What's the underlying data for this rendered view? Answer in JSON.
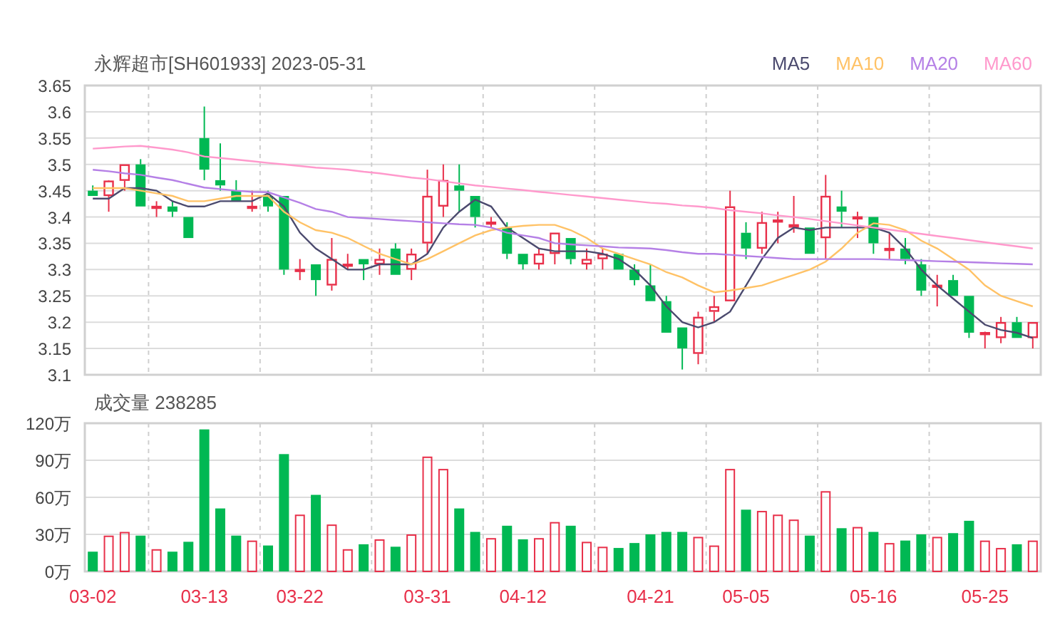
{
  "price_chart": {
    "chart_data": {
      "type": "candlestick",
      "title": "永辉超市[SH601933] 2023-05-31",
      "grid": true,
      "ylim": [
        3.1,
        3.65
      ],
      "yticks": [
        3.1,
        3.15,
        3.2,
        3.25,
        3.3,
        3.35,
        3.4,
        3.45,
        3.5,
        3.55,
        3.6,
        3.65
      ],
      "categories": [
        null,
        null,
        null,
        null,
        null,
        null,
        null,
        null,
        null,
        null,
        null,
        null,
        null,
        null,
        null,
        null,
        null,
        null,
        null,
        null,
        null,
        null,
        null,
        null,
        null,
        null,
        null,
        null,
        null,
        null,
        null,
        null,
        null,
        null,
        null,
        null,
        null,
        null,
        null,
        null,
        null,
        null,
        null,
        null,
        null,
        null,
        null,
        null,
        null,
        null,
        null,
        null,
        null,
        null,
        null,
        null,
        null,
        null,
        null,
        null
      ],
      "ohlc": [
        [
          3.45,
          3.46,
          3.44,
          3.44
        ],
        [
          3.44,
          3.47,
          3.41,
          3.469
        ],
        [
          3.469,
          3.5,
          3.45,
          3.5
        ],
        [
          3.5,
          3.51,
          3.42,
          3.42
        ],
        [
          3.42,
          3.43,
          3.4,
          3.421
        ],
        [
          3.42,
          3.43,
          3.4,
          3.41
        ],
        [
          3.4,
          3.4,
          3.36,
          3.36
        ],
        [
          3.55,
          3.61,
          3.47,
          3.49
        ],
        [
          3.47,
          3.54,
          3.45,
          3.46
        ],
        [
          3.45,
          3.47,
          3.43,
          3.43
        ],
        [
          3.42,
          3.45,
          3.41,
          3.421
        ],
        [
          3.44,
          3.45,
          3.41,
          3.42
        ],
        [
          3.44,
          3.44,
          3.29,
          3.3
        ],
        [
          3.3,
          3.32,
          3.28,
          3.301
        ],
        [
          3.31,
          3.31,
          3.25,
          3.28
        ],
        [
          3.27,
          3.36,
          3.26,
          3.32
        ],
        [
          3.31,
          3.33,
          3.3,
          3.311
        ],
        [
          3.32,
          3.32,
          3.28,
          3.31
        ],
        [
          3.31,
          3.34,
          3.29,
          3.32
        ],
        [
          3.34,
          3.35,
          3.29,
          3.29
        ],
        [
          3.3,
          3.34,
          3.28,
          3.33
        ],
        [
          3.35,
          3.49,
          3.33,
          3.44
        ],
        [
          3.42,
          3.5,
          3.4,
          3.47
        ],
        [
          3.46,
          3.5,
          3.41,
          3.45
        ],
        [
          3.44,
          3.44,
          3.38,
          3.4
        ],
        [
          3.39,
          3.4,
          3.38,
          3.391
        ],
        [
          3.38,
          3.39,
          3.32,
          3.33
        ],
        [
          3.33,
          3.33,
          3.3,
          3.31
        ],
        [
          3.31,
          3.34,
          3.3,
          3.33
        ],
        [
          3.33,
          3.37,
          3.31,
          3.37
        ],
        [
          3.36,
          3.36,
          3.31,
          3.32
        ],
        [
          3.31,
          3.34,
          3.3,
          3.32
        ],
        [
          3.32,
          3.34,
          3.3,
          3.33
        ],
        [
          3.33,
          3.33,
          3.3,
          3.3
        ],
        [
          3.3,
          3.31,
          3.27,
          3.28
        ],
        [
          3.27,
          3.31,
          3.24,
          3.24
        ],
        [
          3.24,
          3.25,
          3.18,
          3.18
        ],
        [
          3.19,
          3.19,
          3.11,
          3.15
        ],
        [
          3.14,
          3.22,
          3.12,
          3.21
        ],
        [
          3.22,
          3.25,
          3.2,
          3.23
        ],
        [
          3.24,
          3.45,
          3.24,
          3.42
        ],
        [
          3.37,
          3.39,
          3.32,
          3.34
        ],
        [
          3.34,
          3.41,
          3.33,
          3.39
        ],
        [
          3.39,
          3.41,
          3.35,
          3.395
        ],
        [
          3.38,
          3.44,
          3.37,
          3.386
        ],
        [
          3.38,
          3.38,
          3.33,
          3.33
        ],
        [
          3.36,
          3.48,
          3.32,
          3.44
        ],
        [
          3.42,
          3.45,
          3.38,
          3.41
        ],
        [
          3.4,
          3.41,
          3.36,
          3.401
        ],
        [
          3.4,
          3.4,
          3.33,
          3.35
        ],
        [
          3.34,
          3.37,
          3.32,
          3.341
        ],
        [
          3.34,
          3.36,
          3.31,
          3.32
        ],
        [
          3.31,
          3.32,
          3.25,
          3.26
        ],
        [
          3.27,
          3.29,
          3.23,
          3.271
        ],
        [
          3.28,
          3.29,
          3.25,
          3.25
        ],
        [
          3.25,
          3.25,
          3.17,
          3.18
        ],
        [
          3.18,
          3.182,
          3.15,
          3.181
        ],
        [
          3.17,
          3.21,
          3.16,
          3.2
        ],
        [
          3.2,
          3.21,
          3.17,
          3.17
        ],
        [
          3.17,
          3.2,
          3.15,
          3.2
        ]
      ]
    }
  },
  "moving_averages": {
    "chart_data": {
      "type": "line",
      "ylim": [
        3.1,
        3.65
      ],
      "categories": [
        null,
        null,
        null,
        null,
        null,
        null,
        null,
        null,
        null,
        null,
        null,
        null,
        null,
        null,
        null,
        null,
        null,
        null,
        null,
        null,
        null,
        null,
        null,
        null,
        null,
        null,
        null,
        null,
        null,
        null,
        null,
        null,
        null,
        null,
        null,
        null,
        null,
        null,
        null,
        null,
        null,
        null,
        null,
        null,
        null,
        null,
        null,
        null,
        null,
        null,
        null,
        null,
        null,
        null,
        null,
        null,
        null,
        null,
        null,
        null
      ],
      "series": [
        {
          "name": "MA5",
          "color": "#4b4a6e",
          "values": [
            3.435,
            3.435,
            3.455,
            3.455,
            3.45,
            3.43,
            3.42,
            3.42,
            3.43,
            3.43,
            3.43,
            3.445,
            3.42,
            3.37,
            3.34,
            3.32,
            3.3,
            3.3,
            3.31,
            3.31,
            3.31,
            3.33,
            3.38,
            3.41,
            3.433,
            3.42,
            3.38,
            3.36,
            3.34,
            3.335,
            3.335,
            3.335,
            3.33,
            3.32,
            3.3,
            3.27,
            3.23,
            3.2,
            3.19,
            3.2,
            3.22,
            3.27,
            3.32,
            3.36,
            3.38,
            3.375,
            3.38,
            3.38,
            3.38,
            3.38,
            3.37,
            3.34,
            3.3,
            3.27,
            3.245,
            3.22,
            3.195,
            3.185,
            3.18,
            3.17
          ]
        },
        {
          "name": "MA10",
          "color": "#ffc266",
          "values": [
            3.455,
            3.455,
            3.455,
            3.45,
            3.445,
            3.44,
            3.43,
            3.43,
            3.435,
            3.44,
            3.44,
            3.44,
            3.41,
            3.39,
            3.375,
            3.37,
            3.36,
            3.345,
            3.33,
            3.32,
            3.31,
            3.32,
            3.335,
            3.35,
            3.365,
            3.375,
            3.38,
            3.383,
            3.385,
            3.385,
            3.375,
            3.36,
            3.34,
            3.33,
            3.32,
            3.31,
            3.295,
            3.285,
            3.27,
            3.257,
            3.26,
            3.265,
            3.27,
            3.28,
            3.29,
            3.3,
            3.315,
            3.34,
            3.37,
            3.388,
            3.385,
            3.375,
            3.355,
            3.34,
            3.32,
            3.3,
            3.27,
            3.25,
            3.24,
            3.23
          ]
        },
        {
          "name": "MA20",
          "color": "#b580e6",
          "values": [
            3.49,
            3.487,
            3.483,
            3.48,
            3.475,
            3.47,
            3.463,
            3.456,
            3.453,
            3.45,
            3.448,
            3.447,
            3.437,
            3.427,
            3.415,
            3.41,
            3.4,
            3.398,
            3.396,
            3.394,
            3.392,
            3.39,
            3.388,
            3.386,
            3.385,
            3.38,
            3.37,
            3.365,
            3.36,
            3.35,
            3.348,
            3.346,
            3.344,
            3.342,
            3.341,
            3.34,
            3.337,
            3.333,
            3.33,
            3.33,
            3.328,
            3.326,
            3.324,
            3.322,
            3.32,
            3.32,
            3.32,
            3.32,
            3.32,
            3.32,
            3.319,
            3.318,
            3.317,
            3.316,
            3.315,
            3.314,
            3.313,
            3.312,
            3.311,
            3.31
          ]
        },
        {
          "name": "MA60",
          "color": "#ff99cc",
          "values": [
            3.53,
            3.532,
            3.534,
            3.535,
            3.532,
            3.528,
            3.523,
            3.515,
            3.512,
            3.509,
            3.506,
            3.503,
            3.5,
            3.497,
            3.494,
            3.492,
            3.49,
            3.486,
            3.483,
            3.479,
            3.475,
            3.472,
            3.468,
            3.464,
            3.46,
            3.457,
            3.454,
            3.451,
            3.448,
            3.445,
            3.442,
            3.439,
            3.436,
            3.433,
            3.43,
            3.427,
            3.425,
            3.422,
            3.42,
            3.417,
            3.413,
            3.41,
            3.407,
            3.403,
            3.4,
            3.396,
            3.392,
            3.388,
            3.384,
            3.38,
            3.376,
            3.372,
            3.368,
            3.364,
            3.36,
            3.356,
            3.352,
            3.348,
            3.344,
            3.34
          ]
        }
      ]
    }
  },
  "volume_chart": {
    "chart_data": {
      "type": "bar",
      "title": "成交量 238285",
      "grid": true,
      "ylim": [
        0,
        120
      ],
      "yticks": [
        {
          "value": 0,
          "label": "0万"
        },
        {
          "value": 30,
          "label": "30万"
        },
        {
          "value": 60,
          "label": "60万"
        },
        {
          "value": 90,
          "label": "90万"
        },
        {
          "value": 120,
          "label": "120万"
        }
      ],
      "categories": [
        "03-02",
        null,
        null,
        null,
        null,
        null,
        null,
        "03-13",
        null,
        null,
        null,
        null,
        null,
        "03-22",
        null,
        null,
        null,
        null,
        null,
        null,
        null,
        "03-31",
        null,
        null,
        null,
        null,
        null,
        "04-12",
        null,
        null,
        null,
        null,
        null,
        null,
        null,
        "04-21",
        null,
        null,
        null,
        null,
        null,
        "05-05",
        null,
        null,
        null,
        null,
        null,
        null,
        null,
        "05-16",
        null,
        null,
        null,
        null,
        null,
        null,
        "05-25",
        null,
        null,
        null
      ],
      "values": [
        16,
        29,
        32,
        29,
        18,
        16,
        24,
        115,
        51,
        29,
        25,
        21,
        95,
        46,
        62,
        38,
        18,
        22,
        26,
        20,
        30,
        93,
        83,
        51,
        32,
        27,
        37,
        26,
        27,
        40,
        37,
        24,
        20,
        19,
        23,
        30,
        32,
        32,
        28,
        21,
        83,
        50,
        49,
        46,
        42,
        29,
        65,
        35,
        36,
        32,
        23,
        25,
        30,
        28,
        31,
        41,
        25,
        19,
        22,
        25
      ]
    }
  }
}
